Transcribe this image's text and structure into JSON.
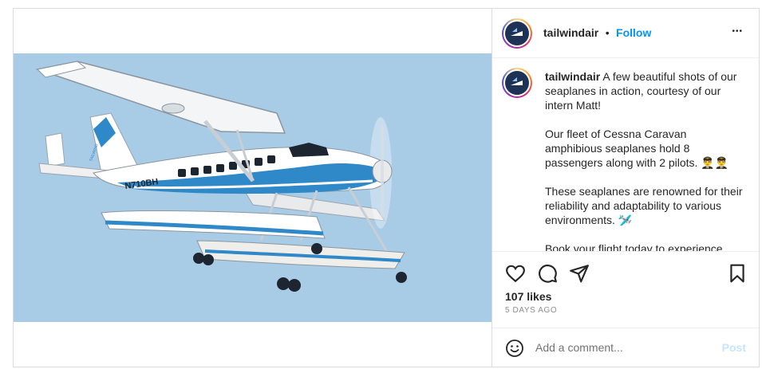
{
  "post": {
    "username": "tailwindair",
    "separator": "•",
    "follow_label": "Follow",
    "more_label": "•••",
    "caption": {
      "username": "tailwindair",
      "paragraphs": [
        "A few beautiful shots of our seaplanes in action, courtesy of our intern Matt!",
        "Our fleet of Cessna Caravan amphibious seaplanes hold 8 passengers along with 2 pilots. 👨‍✈️👨‍✈️",
        "These seaplanes are renowned for their reliability and adaptability to various environments. 🛩️",
        "Book your flight today to experience"
      ]
    },
    "likes": "107 likes",
    "time": "5 DAYS AGO",
    "comment_placeholder": "Add a comment...",
    "post_label": "Post",
    "photo": {
      "tail_number": "N710BH",
      "logo_text": "TAILWIND",
      "sky_color": "#a8cbe6"
    }
  },
  "colors": {
    "accent": "#0095f6",
    "text": "#262626",
    "muted": "#8e8e8e",
    "border": "#dbdbdb",
    "plane_blue": "#2f88c8"
  },
  "icons": [
    "heart-icon",
    "comment-icon",
    "share-icon",
    "bookmark-icon",
    "emoji-icon",
    "more-icon"
  ]
}
